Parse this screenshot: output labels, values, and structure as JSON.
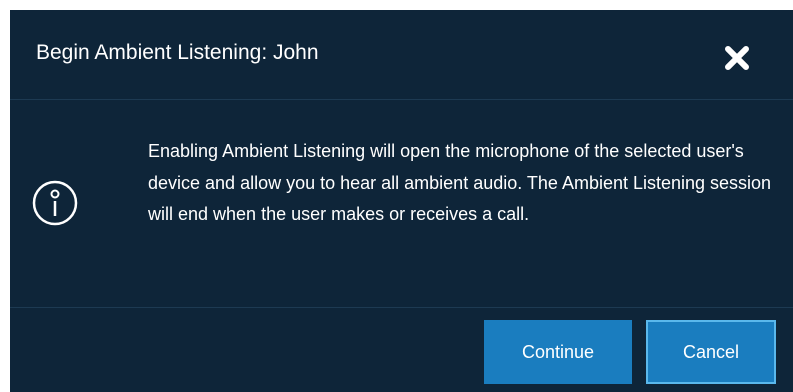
{
  "dialog": {
    "title": "Begin Ambient Listening: John",
    "close_icon": "close-icon",
    "info_icon": "info-icon",
    "message": "Enabling Ambient Listening will open the microphone of the selected user's device and allow you to hear all ambient audio. The Ambient Listening session will end when the user makes or receives a call.",
    "buttons": {
      "continue_label": "Continue",
      "cancel_label": "Cancel"
    }
  },
  "colors": {
    "dialog_background": "#0e2539",
    "divider": "#1d3a52",
    "button_background": "#1a7dbf",
    "button_focus_border": "#5ab8ec",
    "text": "#ffffff"
  }
}
